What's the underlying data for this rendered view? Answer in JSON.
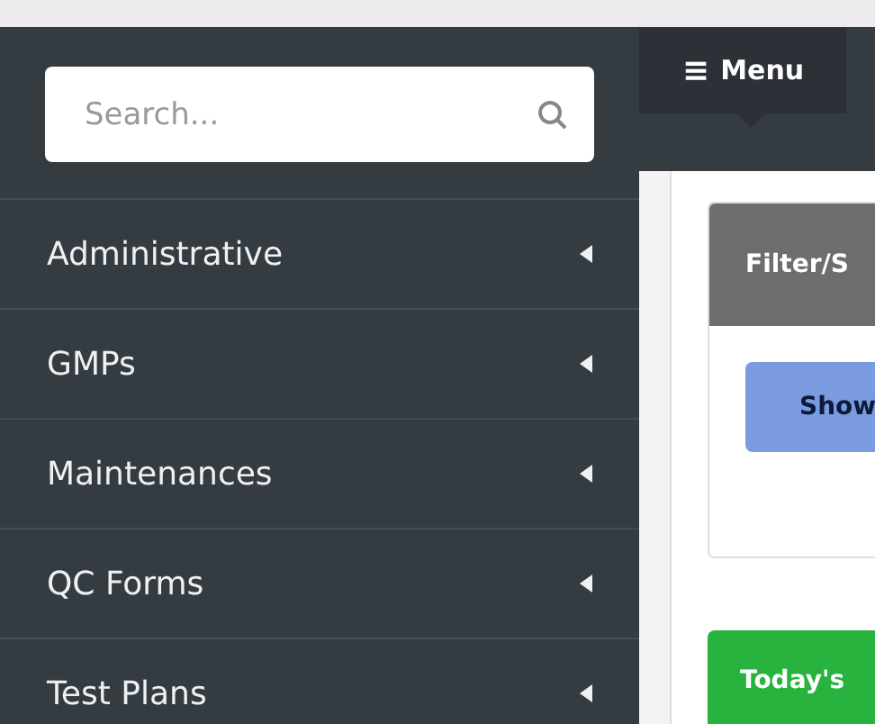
{
  "sidebar": {
    "search": {
      "placeholder": "Search..."
    },
    "items": [
      {
        "label": "Administrative",
        "expanded": false
      },
      {
        "label": "GMPs",
        "expanded": false
      },
      {
        "label": "Maintenances",
        "expanded": false
      },
      {
        "label": "QC Forms",
        "expanded": false
      },
      {
        "label": "Test Plans",
        "expanded": false
      }
    ]
  },
  "header": {
    "menu_button": {
      "icon": "≡",
      "label": "Menu"
    }
  },
  "content": {
    "filter_card": {
      "title": "Filter/S",
      "button": "Show"
    },
    "today_card": {
      "title": "Today's"
    }
  }
}
